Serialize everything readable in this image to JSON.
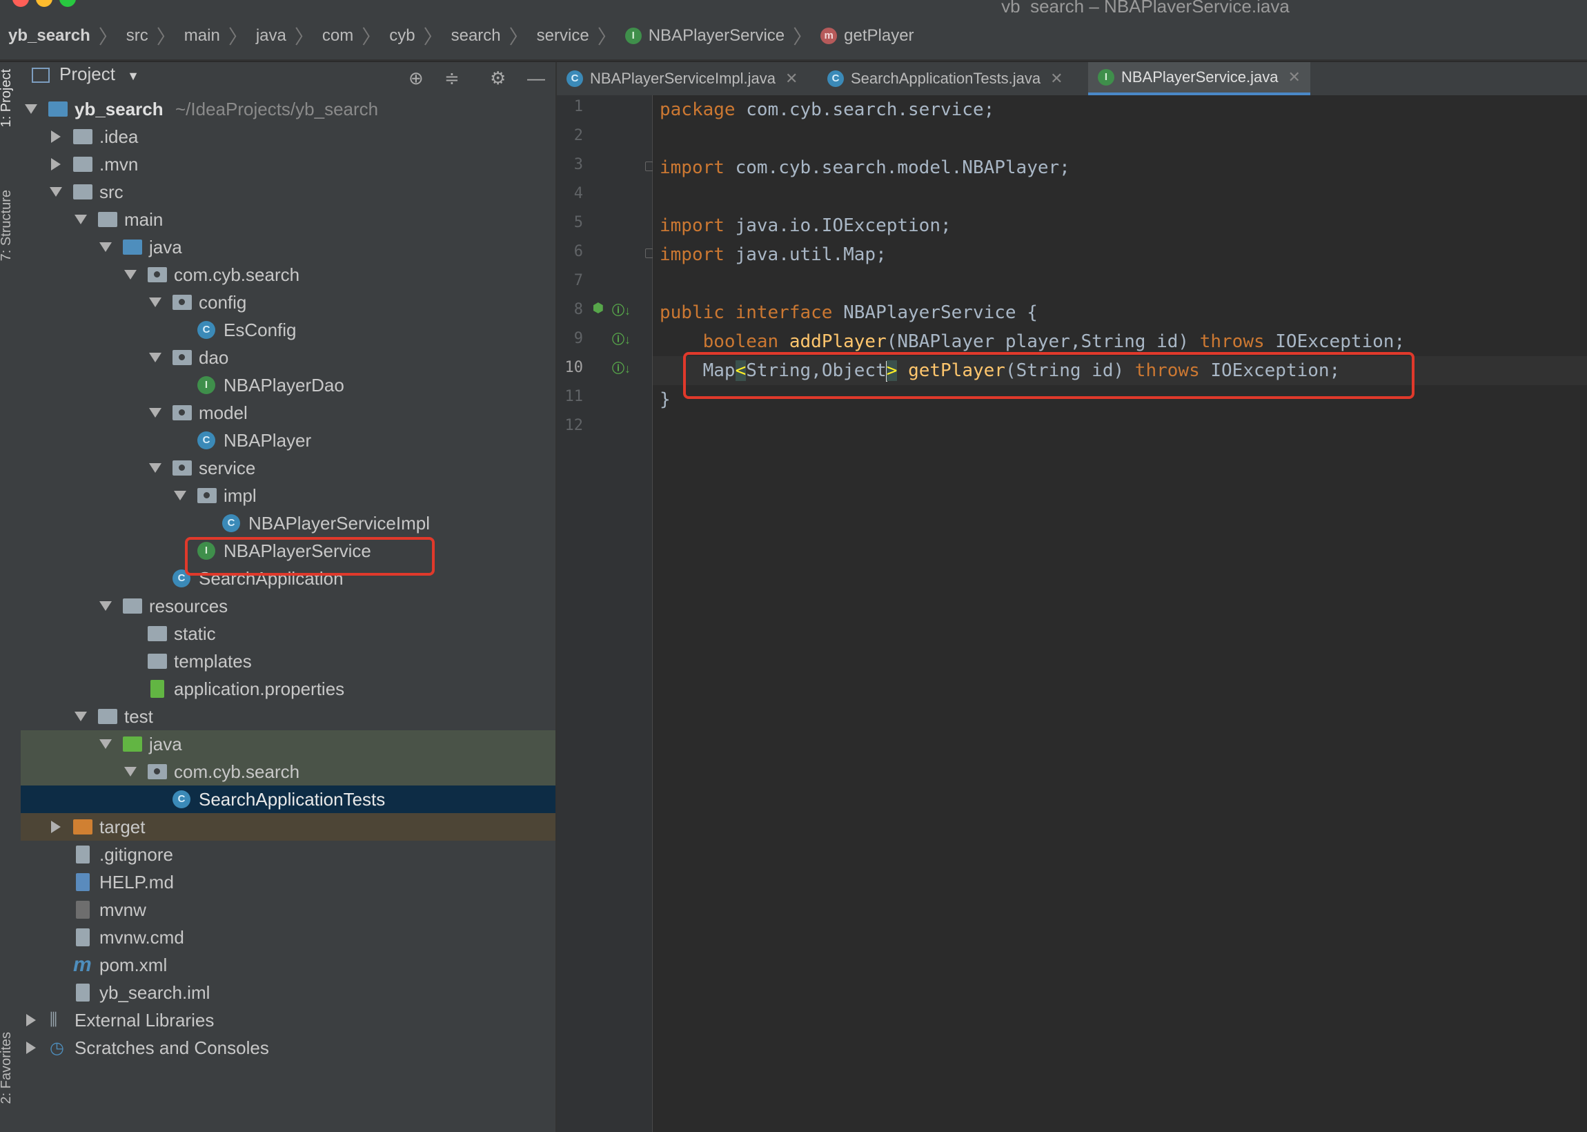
{
  "window": {
    "title": "yb_search – NBAPlayerService.java",
    "traffic_colors": [
      "#ff5f57",
      "#febc2e",
      "#28c840"
    ]
  },
  "navbar": {
    "breadcrumbs": [
      "yb_search",
      "src",
      "main",
      "java",
      "com",
      "cyb",
      "search",
      "service",
      "NBAPlayerService",
      "getPlayer"
    ],
    "interface_badge": "I",
    "method_badge": "m"
  },
  "left_strip": {
    "tabs": [
      "1: Project",
      "7: Structure",
      "2: Favorites"
    ]
  },
  "project_panel": {
    "title": "Project",
    "icons": [
      "locate-icon",
      "collapse-icon",
      "gear-icon",
      "minimize-icon"
    ]
  },
  "tree": {
    "root_name": "yb_search",
    "root_path": "~/IdeaProjects/yb_search",
    "items": [
      {
        "label": ".idea"
      },
      {
        "label": ".mvn"
      },
      {
        "label": "src"
      },
      {
        "label": "main"
      },
      {
        "label": "java"
      },
      {
        "label": "com.cyb.search"
      },
      {
        "label": "config"
      },
      {
        "label": "EsConfig",
        "badge": "C"
      },
      {
        "label": "dao"
      },
      {
        "label": "NBAPlayerDao",
        "badge": "I"
      },
      {
        "label": "model"
      },
      {
        "label": "NBAPlayer",
        "badge": "C"
      },
      {
        "label": "service"
      },
      {
        "label": "impl"
      },
      {
        "label": "NBAPlayerServiceImpl",
        "badge": "C"
      },
      {
        "label": "NBAPlayerService",
        "badge": "I"
      },
      {
        "label": "SearchApplication",
        "badge": "C"
      },
      {
        "label": "resources"
      },
      {
        "label": "static"
      },
      {
        "label": "templates"
      },
      {
        "label": "application.properties"
      },
      {
        "label": "test"
      },
      {
        "label": "java"
      },
      {
        "label": "com.cyb.search"
      },
      {
        "label": "SearchApplicationTests",
        "badge": "C"
      },
      {
        "label": "target"
      },
      {
        "label": ".gitignore"
      },
      {
        "label": "HELP.md"
      },
      {
        "label": "mvnw"
      },
      {
        "label": "mvnw.cmd"
      },
      {
        "label": "pom.xml"
      },
      {
        "label": "yb_search.iml"
      },
      {
        "label": "External Libraries"
      },
      {
        "label": "Scratches and Consoles"
      }
    ]
  },
  "tabs": [
    {
      "label": "NBAPlayerServiceImpl.java",
      "badge": "C"
    },
    {
      "label": "SearchApplicationTests.java",
      "badge": "C"
    },
    {
      "label": "NBAPlayerService.java",
      "badge": "I"
    }
  ],
  "editor": {
    "line_numbers": [
      "1",
      "2",
      "3",
      "4",
      "5",
      "6",
      "7",
      "8",
      "9",
      "10",
      "11",
      "12"
    ],
    "code": {
      "l1_kw": "package",
      "l1_rest": " com.cyb.search.service;",
      "l3_kw": "import",
      "l3_rest": " com.cyb.search.model.NBAPlayer;",
      "l5_kw": "import",
      "l5_rest": " java.io.IOException;",
      "l6_kw": "import",
      "l6_rest": " java.util.Map;",
      "l8_kw": "public interface",
      "l8_rest": " NBAPlayerService {",
      "l9_indent": "    ",
      "l9_kw": "boolean",
      "l9_sp": " ",
      "l9_fn": "addPlayer",
      "l9_args": "(NBAPlayer player,String id) ",
      "l9_throws": "throws",
      "l9_end": " IOException;",
      "l10_indent": "    ",
      "l10_map": "Map",
      "l10_lt": "<",
      "l10_mid": "String,Object",
      "l10_gt": ">",
      "l10_sp": " ",
      "l10_fn": "getPlayer",
      "l10_args": "(String id) ",
      "l10_throws": "throws",
      "l10_end": " IOException;",
      "l11": "}"
    }
  },
  "colors": {
    "keyword": "#cc7832",
    "function": "#ffc66d",
    "annotation_box": "#e0392b",
    "active_tab_underline": "#4a88c7"
  }
}
